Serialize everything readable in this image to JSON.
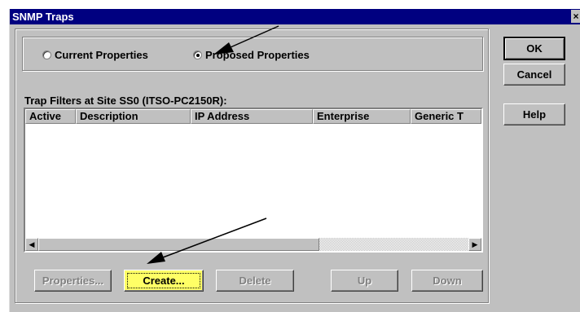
{
  "window": {
    "title": "SNMP Traps",
    "close_label": "×"
  },
  "radios": [
    {
      "label": "Current Properties",
      "checked": false
    },
    {
      "label": "Proposed Properties",
      "checked": true
    }
  ],
  "filters_label": "Trap Filters at Site SS0 (ITSO-PC2150R):",
  "columns": [
    "Active",
    "Description",
    "IP Address",
    "Enterprise",
    "Generic T"
  ],
  "rows": [],
  "scrollbar": {
    "left_arrow": "◀",
    "right_arrow": "▶"
  },
  "buttons": {
    "properties": "Properties...",
    "create": "Create...",
    "delete": "Delete",
    "up": "Up",
    "down": "Down",
    "ok": "OK",
    "cancel": "Cancel",
    "help": "Help"
  },
  "colors": {
    "title_bar": "#000080",
    "highlight": "#ffff66",
    "face": "#c0c0c0"
  }
}
